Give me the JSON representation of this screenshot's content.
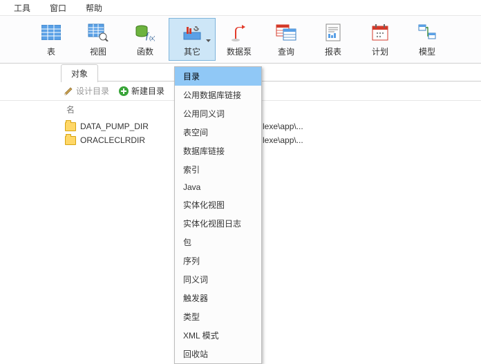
{
  "menu": {
    "items": [
      "工具",
      "窗口",
      "帮助"
    ]
  },
  "ribbon": {
    "items": [
      {
        "label": "表"
      },
      {
        "label": "视图"
      },
      {
        "label": "函数"
      },
      {
        "label": "其它"
      },
      {
        "label": "数据泵"
      },
      {
        "label": "查询"
      },
      {
        "label": "报表"
      },
      {
        "label": "计划"
      },
      {
        "label": "模型"
      }
    ]
  },
  "tabs": {
    "items": [
      "对象"
    ]
  },
  "toolbar": {
    "design_label": "设计目录",
    "new_label": "新建目录"
  },
  "table": {
    "col_name": "名",
    "rows": [
      {
        "name": "DATA_PUMP_DIR",
        "path": "lexe\\app\\..."
      },
      {
        "name": "ORACLECLRDIR",
        "path": "lexe\\app\\..."
      }
    ]
  },
  "dropdown": {
    "items": [
      "目录",
      "公用数据库链接",
      "公用同义词",
      "表空间",
      "数据库链接",
      "索引",
      "Java",
      "实体化视图",
      "实体化视图日志",
      "包",
      "序列",
      "同义词",
      "触发器",
      "类型",
      "XML 模式",
      "回收站"
    ],
    "highlight_index": 0
  }
}
